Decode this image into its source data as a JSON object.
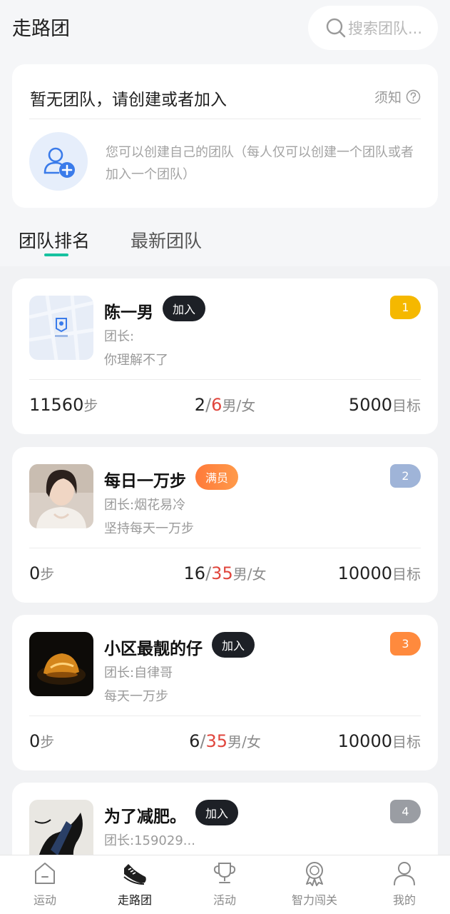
{
  "header": {
    "title": "走路团",
    "search_placeholder": "搜索团队..."
  },
  "notice": {
    "title": "暂无团队，请创建或者加入",
    "help_label": "须知",
    "description": "您可以创建自己的团队（每人仅可以创建一个团队或者加入一个团队）"
  },
  "tabs": [
    {
      "label": "团队排名",
      "active": true
    },
    {
      "label": "最新团队",
      "active": false
    }
  ],
  "teams": [
    {
      "name": "陈一男",
      "badge": "加入",
      "badge_type": "join",
      "leader": "团长:",
      "motto": "你理解不了",
      "rank": "1",
      "rank_color": "#f5b800",
      "steps": "11560",
      "steps_unit": "步",
      "male": "2",
      "female": "6",
      "gender_label": "男/女",
      "target": "5000",
      "target_unit": "目标",
      "thumb": "map-placeholder-image"
    },
    {
      "name": "每日一万步",
      "badge": "满员",
      "badge_type": "full",
      "leader": "团长:烟花易冷",
      "motto": "坚持每天一万步",
      "rank": "2",
      "rank_color": "#9fb4d8",
      "steps": "0",
      "steps_unit": "步",
      "male": "16",
      "female": "35",
      "gender_label": "男/女",
      "target": "10000",
      "target_unit": "目标",
      "thumb": "person-photo"
    },
    {
      "name": "小区最靓的仔",
      "badge": "加入",
      "badge_type": "join",
      "leader": "团长:自律哥",
      "motto": "每天一万步",
      "rank": "3",
      "rank_color": "#ff8a3d",
      "steps": "0",
      "steps_unit": "步",
      "male": "6",
      "female": "35",
      "gender_label": "男/女",
      "target": "10000",
      "target_unit": "目标",
      "thumb": "glowing-object-photo"
    },
    {
      "name": "为了减肥。",
      "badge": "加入",
      "badge_type": "join",
      "leader": "团长:159029...",
      "rank": "4",
      "rank_color": "#9a9da3",
      "thumb": "ink-art-photo"
    }
  ],
  "tabbar": [
    {
      "label": "运动",
      "icon": "home-icon",
      "active": false
    },
    {
      "label": "走路团",
      "icon": "sneaker-icon",
      "active": true
    },
    {
      "label": "活动",
      "icon": "trophy-icon",
      "active": false
    },
    {
      "label": "智力闯关",
      "icon": "medal-icon",
      "active": false
    },
    {
      "label": "我的",
      "icon": "user-icon",
      "active": false
    }
  ]
}
